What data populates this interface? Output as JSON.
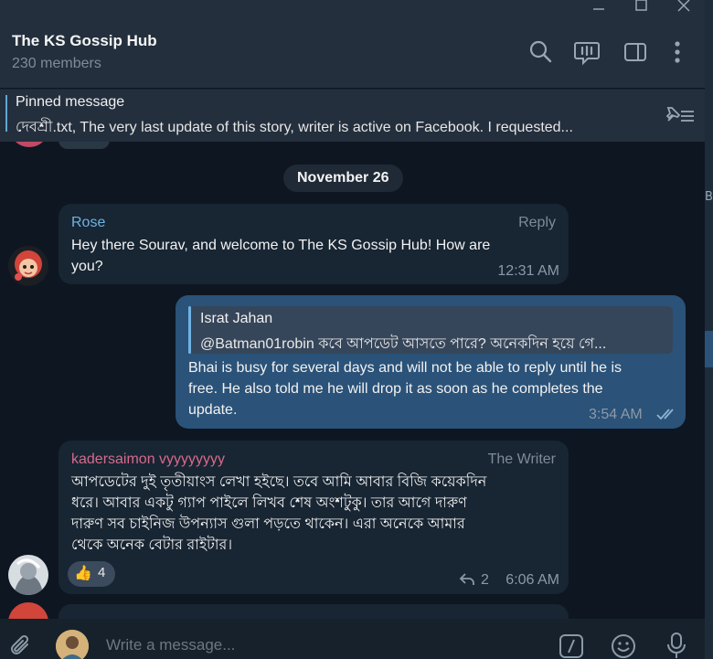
{
  "window": {
    "controls": [
      "minimize",
      "maximize",
      "close"
    ]
  },
  "header": {
    "title": "The KS Gossip Hub",
    "members": "230 members",
    "icons": [
      "search-icon",
      "video-chat-icon",
      "sidebar-toggle-icon",
      "more-options-icon"
    ]
  },
  "pinned": {
    "title": "Pinned message",
    "text": "দেবশ্রী.txt, The very last update of this story, writer is active on Facebook. I requested..."
  },
  "messages": {
    "date_label": "November 26",
    "m1": {
      "sender": "Rose",
      "role": "Reply",
      "lines": [
        "Hey there Sourav, and welcome to The KS Gossip Hub! How are",
        "you?"
      ],
      "time": "12:31 AM"
    },
    "m2": {
      "reply_name": "Israt Jahan",
      "reply_text": "@Batman01robin কবে আপডেট আসতে পারে? অনেকদিন হয়ে গে...",
      "lines": [
        "Bhai is busy for several days and will not be able to reply until he is",
        "free. He also told me he will drop it as soon as he completes the",
        "update."
      ],
      "time": "3:54 AM"
    },
    "m3": {
      "sender": "kadersaimon vyyyyyyyy",
      "role": "The Writer",
      "lines": [
        "আপডেটের দুই তৃতীয়াংস লেখা হইছে। তবে আমি আবার বিজি কয়েকদিন",
        "ধরে। আবার একটু গ্যাপ পাইলে লিখব শেষ অংশটুকু। তার আগে দারুণ",
        "দারুণ সব চাইনিজ উপন্যাস গুলা পড়তে থাকেন। এরা অনেকে আমার",
        "থেকে অনেক বেটার রাইটার।"
      ],
      "reaction_emoji": "👍",
      "reaction_count": "4",
      "replies": "2",
      "time": "6:06 AM"
    }
  },
  "composer": {
    "placeholder": "Write a message..."
  },
  "colors": {
    "bg": "#0e1621",
    "header": "#242f3d",
    "incoming": "#182533",
    "outgoing": "#2b5278",
    "rose_name": "#6fb3e2",
    "writer_name": "#d66a8b"
  }
}
